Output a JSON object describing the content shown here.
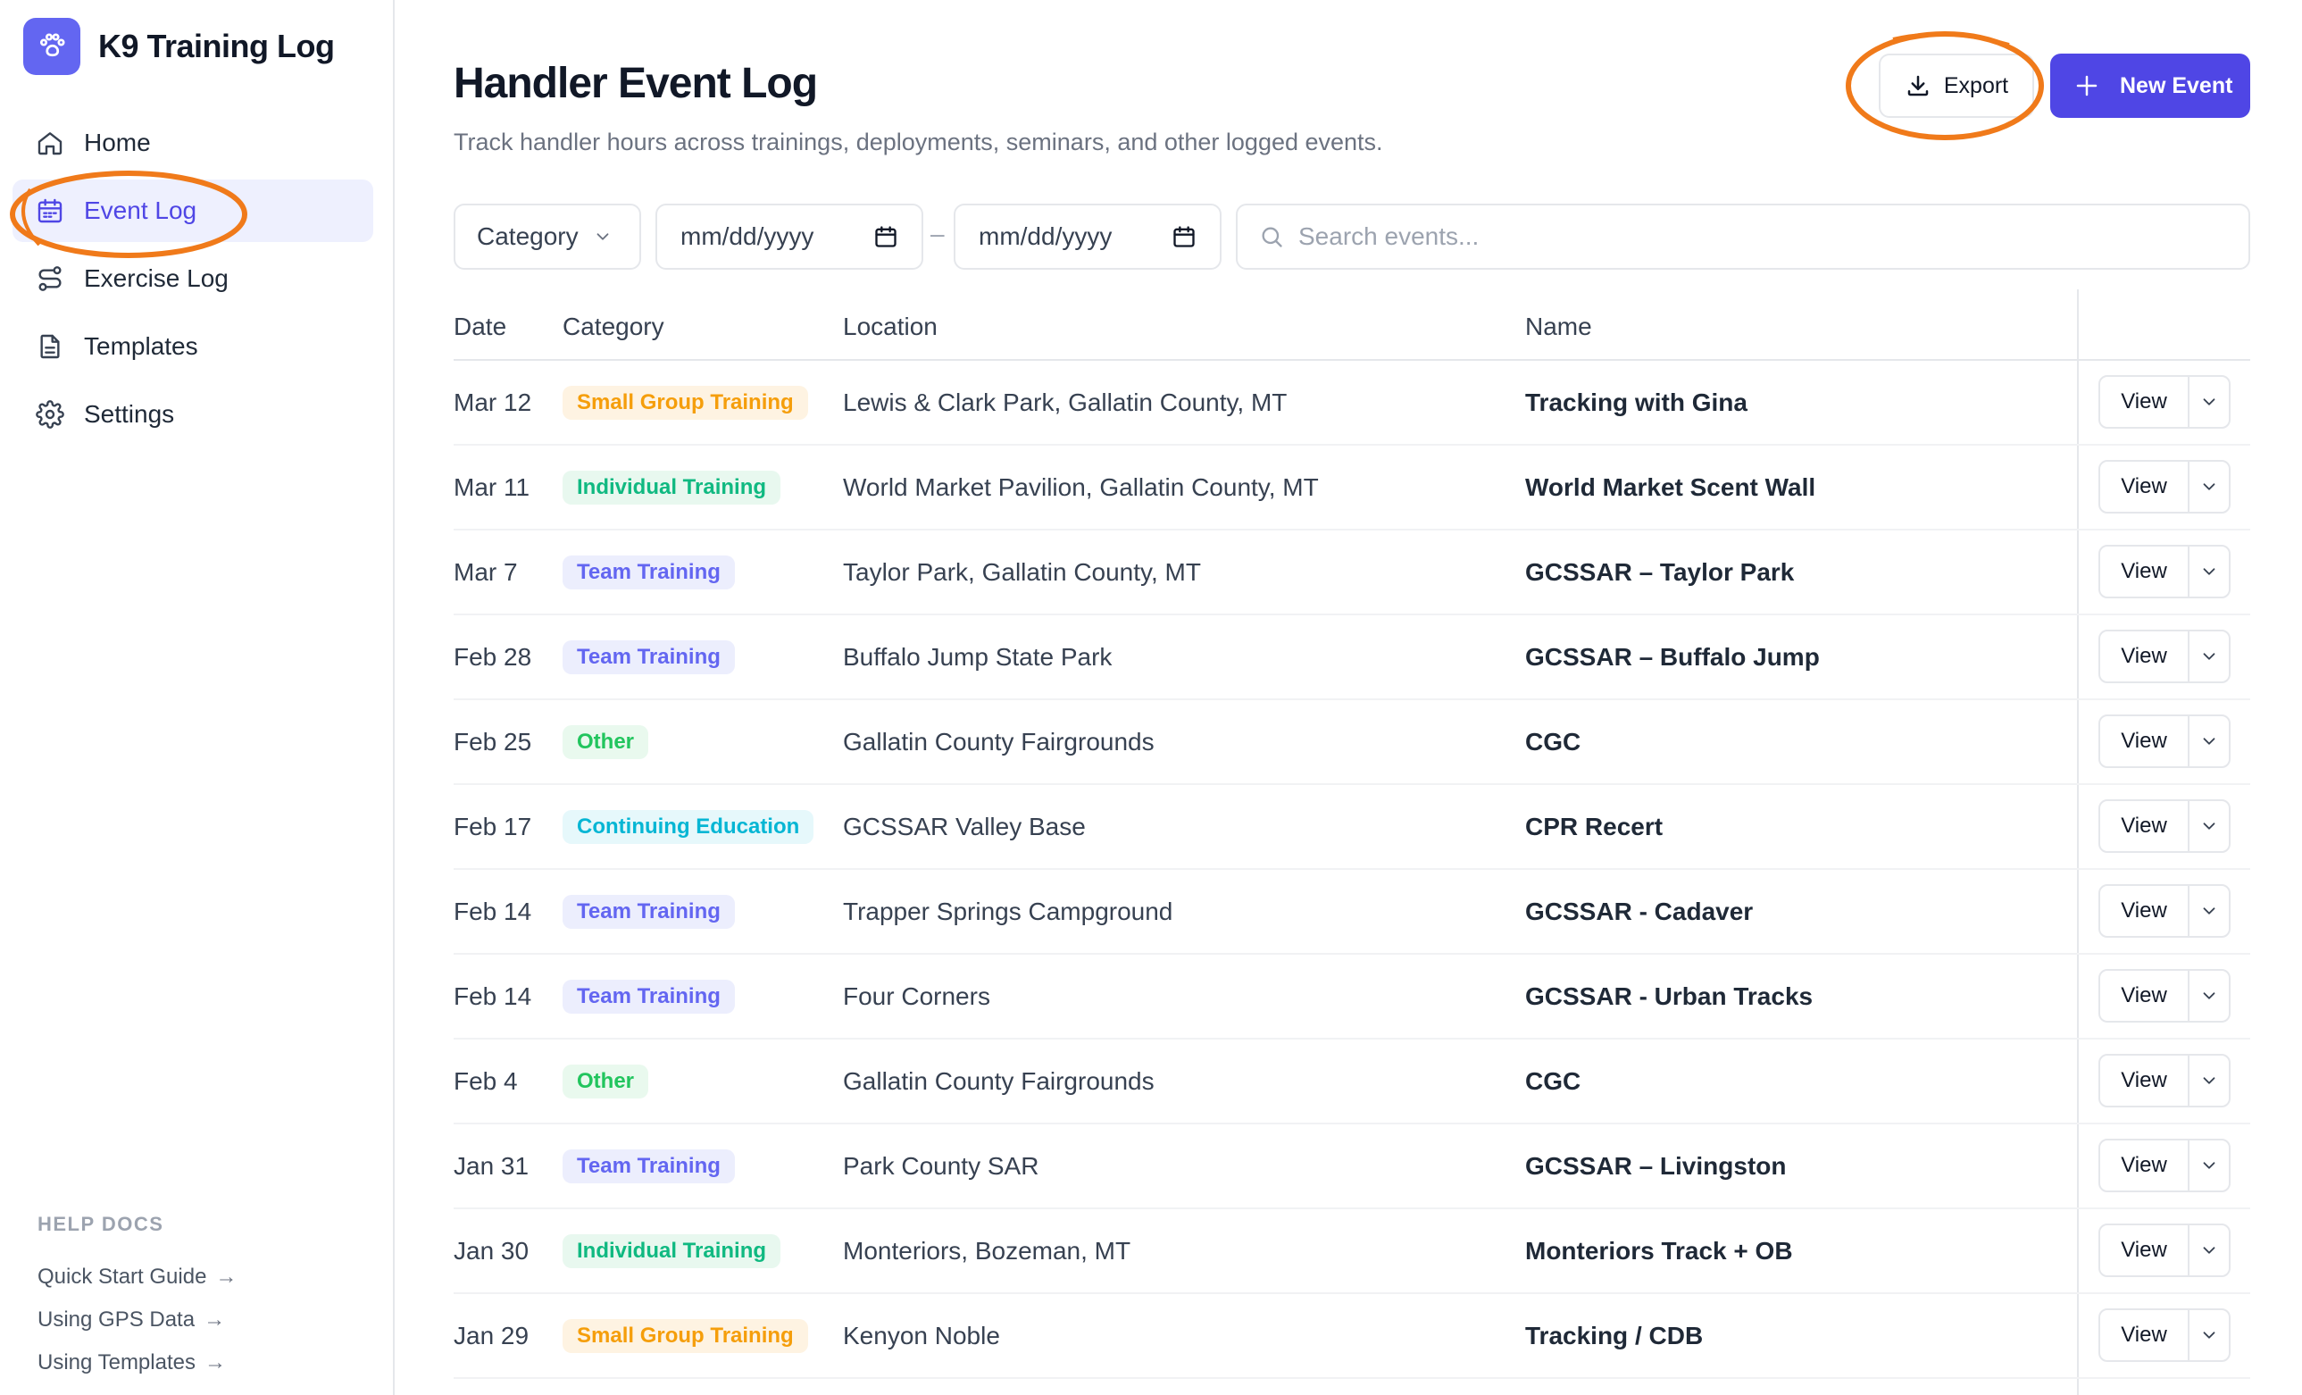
{
  "app": {
    "title": "K9 Training Log",
    "accent": "#4f46e5",
    "annotation_color": "#f07a1a"
  },
  "sidebar": {
    "items": [
      {
        "label": "Home",
        "icon": "home-icon",
        "active": false
      },
      {
        "label": "Event Log",
        "icon": "calendar-icon",
        "active": true
      },
      {
        "label": "Exercise Log",
        "icon": "route-icon",
        "active": false
      },
      {
        "label": "Templates",
        "icon": "document-icon",
        "active": false
      },
      {
        "label": "Settings",
        "icon": "gear-icon",
        "active": false
      }
    ],
    "help": {
      "title": "HELP DOCS",
      "links": [
        {
          "label": "Quick Start Guide",
          "arrow": "→"
        },
        {
          "label": "Using GPS Data",
          "arrow": "→"
        },
        {
          "label": "Using Templates",
          "arrow": "→"
        }
      ]
    }
  },
  "header": {
    "title": "Handler Event Log",
    "subtitle": "Track handler hours across trainings, deployments, seminars, and other logged events.",
    "export_label": "Export",
    "new_event_label": "New Event"
  },
  "filters": {
    "category_label": "Category",
    "date_from_placeholder": "mm/dd/yyyy",
    "date_separator": "–",
    "date_to_placeholder": "mm/dd/yyyy",
    "search_placeholder": "Search events..."
  },
  "table": {
    "headers": {
      "date": "Date",
      "category": "Category",
      "location": "Location",
      "name": "Name"
    },
    "view_label": "View",
    "category_colors": {
      "Small Group Training": {
        "bg": "#fef3e2",
        "fg": "#f59e0b"
      },
      "Individual Training": {
        "bg": "#e8f8ef",
        "fg": "#10b981"
      },
      "Team Training": {
        "bg": "#eceefd",
        "fg": "#6366f1"
      },
      "Other": {
        "bg": "#e9f9ee",
        "fg": "#22c55e"
      },
      "Continuing Education": {
        "bg": "#e6f8fb",
        "fg": "#06b6d4"
      }
    },
    "rows": [
      {
        "date": "Mar 12",
        "category": "Small Group Training",
        "location": "Lewis & Clark Park, Gallatin County, MT",
        "name": "Tracking with Gina"
      },
      {
        "date": "Mar 11",
        "category": "Individual Training",
        "location": "World Market Pavilion, Gallatin County, MT",
        "name": "World Market Scent Wall"
      },
      {
        "date": "Mar 7",
        "category": "Team Training",
        "location": "Taylor Park, Gallatin County, MT",
        "name": "GCSSAR – Taylor Park"
      },
      {
        "date": "Feb 28",
        "category": "Team Training",
        "location": "Buffalo Jump State Park",
        "name": "GCSSAR – Buffalo Jump"
      },
      {
        "date": "Feb 25",
        "category": "Other",
        "location": "Gallatin County Fairgrounds",
        "name": "CGC"
      },
      {
        "date": "Feb 17",
        "category": "Continuing Education",
        "location": "GCSSAR Valley Base",
        "name": "CPR Recert"
      },
      {
        "date": "Feb 14",
        "category": "Team Training",
        "location": "Trapper Springs Campground",
        "name": "GCSSAR - Cadaver"
      },
      {
        "date": "Feb 14",
        "category": "Team Training",
        "location": "Four Corners",
        "name": "GCSSAR - Urban Tracks"
      },
      {
        "date": "Feb 4",
        "category": "Other",
        "location": "Gallatin County Fairgrounds",
        "name": "CGC"
      },
      {
        "date": "Jan 31",
        "category": "Team Training",
        "location": "Park County SAR",
        "name": "GCSSAR – Livingston"
      },
      {
        "date": "Jan 30",
        "category": "Individual Training",
        "location": "Monteriors, Bozeman, MT",
        "name": "Monteriors Track + OB"
      },
      {
        "date": "Jan 29",
        "category": "Small Group Training",
        "location": "Kenyon Noble",
        "name": "Tracking / CDB"
      }
    ]
  }
}
